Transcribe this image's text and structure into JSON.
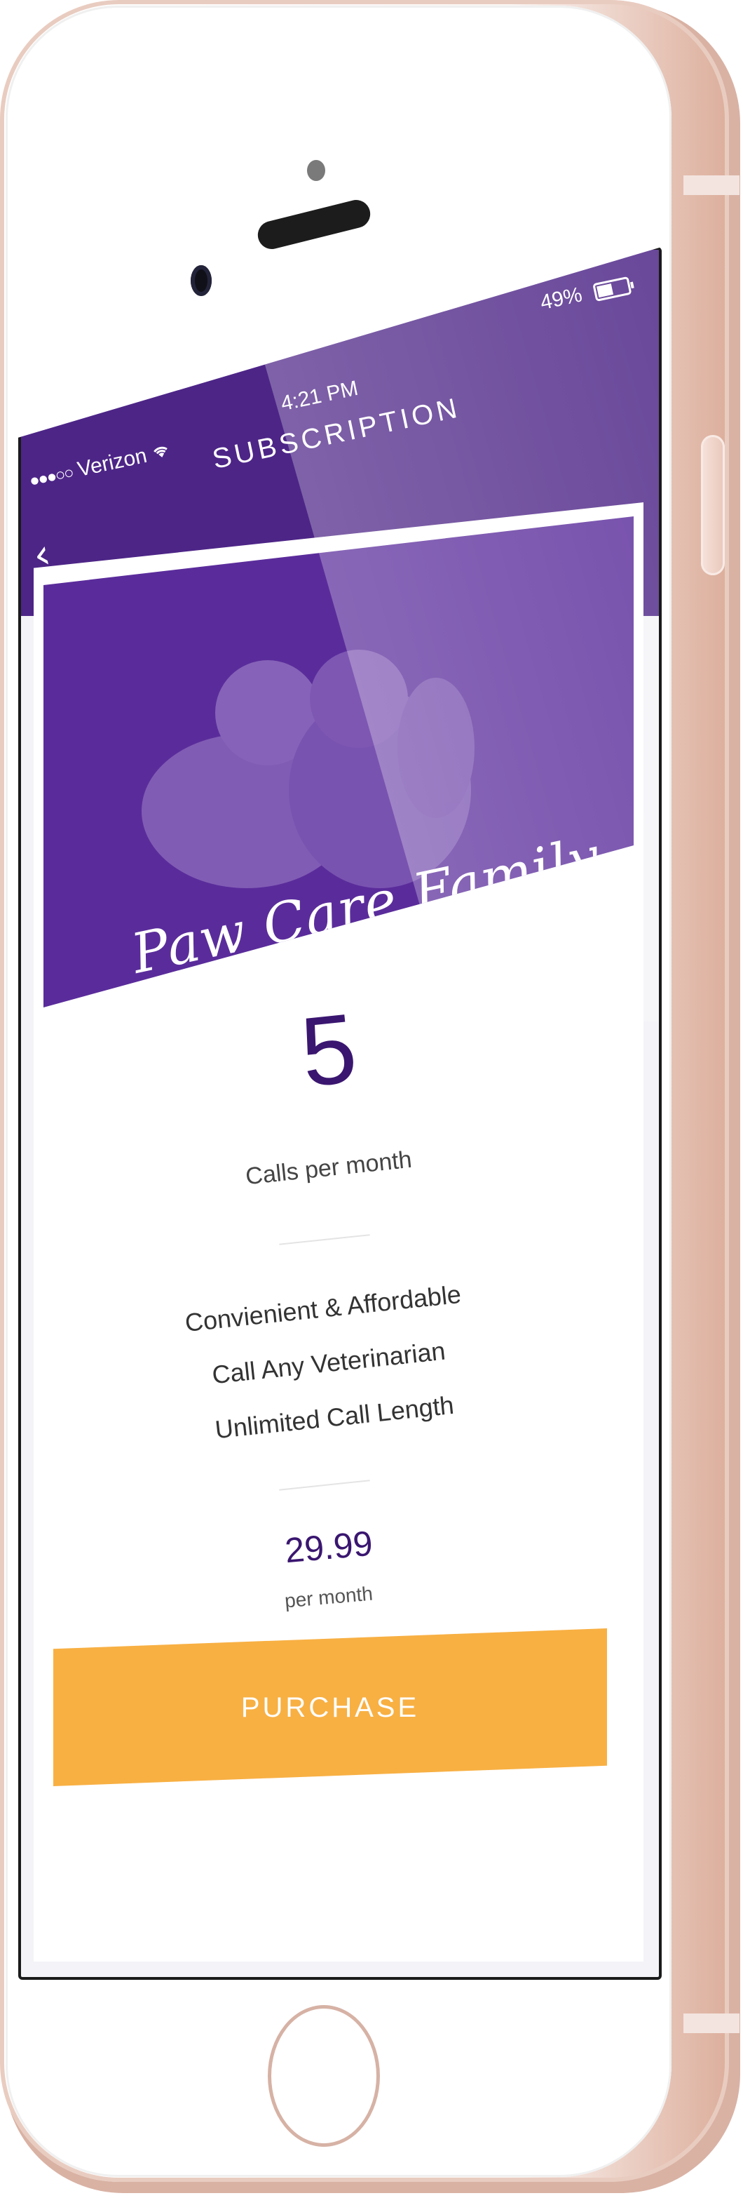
{
  "status_bar": {
    "carrier": "Verizon",
    "signal_dots": "●●●○○",
    "time": "4:21 PM",
    "battery_percent": "49%"
  },
  "header": {
    "title": "SUBSCRIPTION",
    "back_icon": "chevron-left-icon"
  },
  "plan": {
    "name": "Paw Care Family",
    "calls_count": "5",
    "calls_label": "Calls per month",
    "features": [
      "Convienient & Affordable",
      "Call Any Veterinarian",
      "Unlimited Call Length"
    ],
    "price": "29.99",
    "price_unit": "per month"
  },
  "actions": {
    "purchase_label": "PURCHASE"
  },
  "colors": {
    "header_purple": "#4d2587",
    "hero_purple": "#5a2c9b",
    "accent_text": "#3a1670",
    "purchase_orange": "#f8b043",
    "phone_rose_gold": "#e7c6b9"
  }
}
